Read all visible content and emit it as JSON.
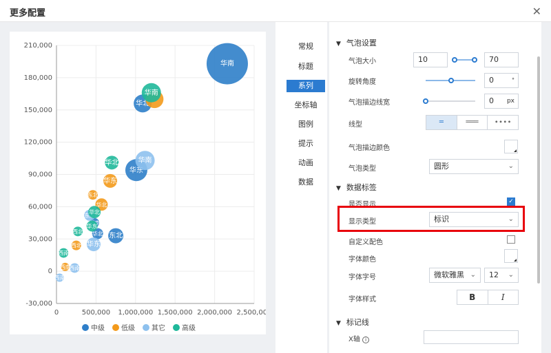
{
  "dialog": {
    "title": "更多配置",
    "close_glyph": "✕"
  },
  "nav": {
    "items": [
      "常规",
      "标题",
      "系列",
      "坐标轴",
      "图例",
      "提示",
      "动画",
      "数据"
    ],
    "active": 2
  },
  "panel": {
    "bubble_section": "气泡设置",
    "bubble_size_label": "气泡大小",
    "bubble_size_min": "10",
    "bubble_size_max": "70",
    "rotate_label": "旋转角度",
    "rotate_value": "0",
    "rotate_unit": "°",
    "border_width_label": "气泡描边线宽",
    "border_width_value": "0",
    "border_width_unit": "px",
    "line_type_label": "线型",
    "line_types": [
      "═",
      "═══",
      "∙∙∙∙"
    ],
    "border_color_label": "气泡描边颜色",
    "bubble_type_label": "气泡类型",
    "bubble_type_value": "圆形",
    "label_section": "数据标签",
    "show_label": "是否显示",
    "display_type_label": "显示类型",
    "display_type_value": "标识",
    "custom_color_label": "自定义配色",
    "font_color_label": "字体颜色",
    "font_size_label": "字体字号",
    "font_family_value": "微软雅黑",
    "font_size_value": "12",
    "font_style_label": "字体样式",
    "bold_glyph": "B",
    "italic_glyph": "I",
    "markline_section": "标记线",
    "x_axis_label": "X轴"
  },
  "chart_data": {
    "type": "scatter",
    "xlim": [
      0,
      2500000
    ],
    "ylim": [
      -30000,
      210000
    ],
    "x_ticks": [
      "0",
      "500,000",
      "1,000,000",
      "1,500,000",
      "2,000,000",
      "2,500,000"
    ],
    "x_tick_values": [
      0,
      500000,
      1000000,
      1500000,
      2000000,
      2500000
    ],
    "y_ticks": [
      "210,000",
      "180,000",
      "150,000",
      "120,000",
      "90,000",
      "60,000",
      "30,000",
      "0",
      "-30,000"
    ],
    "y_tick_values": [
      210000,
      180000,
      150000,
      120000,
      90000,
      60000,
      30000,
      0,
      -30000
    ],
    "series": [
      {
        "name": "中级",
        "color": "#2f7fc9",
        "points": [
          {
            "x": 2160000,
            "y": 193000,
            "r": 30,
            "label": "华南"
          },
          {
            "x": 1090000,
            "y": 156000,
            "r": 13,
            "label": "华北"
          },
          {
            "x": 1010000,
            "y": 94000,
            "r": 16,
            "label": "华东"
          },
          {
            "x": 750000,
            "y": 33000,
            "r": 11,
            "label": "东北"
          },
          {
            "x": 520000,
            "y": 35000,
            "r": 8,
            "label": "华北"
          },
          {
            "x": 480000,
            "y": 45000,
            "r": 7,
            "label": "西南"
          }
        ]
      },
      {
        "name": "低级",
        "color": "#f39a1b",
        "points": [
          {
            "x": 1240000,
            "y": 160000,
            "r": 13,
            "label": ""
          },
          {
            "x": 680000,
            "y": 84000,
            "r": 10,
            "label": "华东"
          },
          {
            "x": 570000,
            "y": 62000,
            "r": 9,
            "label": "华北"
          },
          {
            "x": 460000,
            "y": 71000,
            "r": 7,
            "label": "东北"
          },
          {
            "x": 250000,
            "y": 24000,
            "r": 7,
            "label": "西北"
          },
          {
            "x": 110000,
            "y": 4000,
            "r": 6,
            "label": "西南"
          }
        ]
      },
      {
        "name": "其它",
        "color": "#8ec1ee",
        "points": [
          {
            "x": 1120000,
            "y": 103000,
            "r": 14,
            "label": "华南"
          },
          {
            "x": 470000,
            "y": 25000,
            "r": 10,
            "label": "华东"
          },
          {
            "x": 420000,
            "y": 52000,
            "r": 8,
            "label": "东北"
          },
          {
            "x": 230000,
            "y": 3000,
            "r": 7,
            "label": "西南"
          },
          {
            "x": 40000,
            "y": -6000,
            "r": 6,
            "label": "西南"
          }
        ]
      },
      {
        "name": "高级",
        "color": "#1fb89a",
        "points": [
          {
            "x": 1200000,
            "y": 166000,
            "r": 14,
            "label": "华南"
          },
          {
            "x": 700000,
            "y": 101000,
            "r": 10,
            "label": "华北"
          },
          {
            "x": 480000,
            "y": 55000,
            "r": 9,
            "label": "华北"
          },
          {
            "x": 450000,
            "y": 42000,
            "r": 8,
            "label": "华东"
          },
          {
            "x": 270000,
            "y": 37000,
            "r": 7,
            "label": "西北"
          },
          {
            "x": 90000,
            "y": 17000,
            "r": 7,
            "label": "西南"
          }
        ]
      }
    ],
    "legend_position": "bottom"
  },
  "colors": {
    "accent": "#2b7bd0",
    "highlight": "#e8000b"
  }
}
